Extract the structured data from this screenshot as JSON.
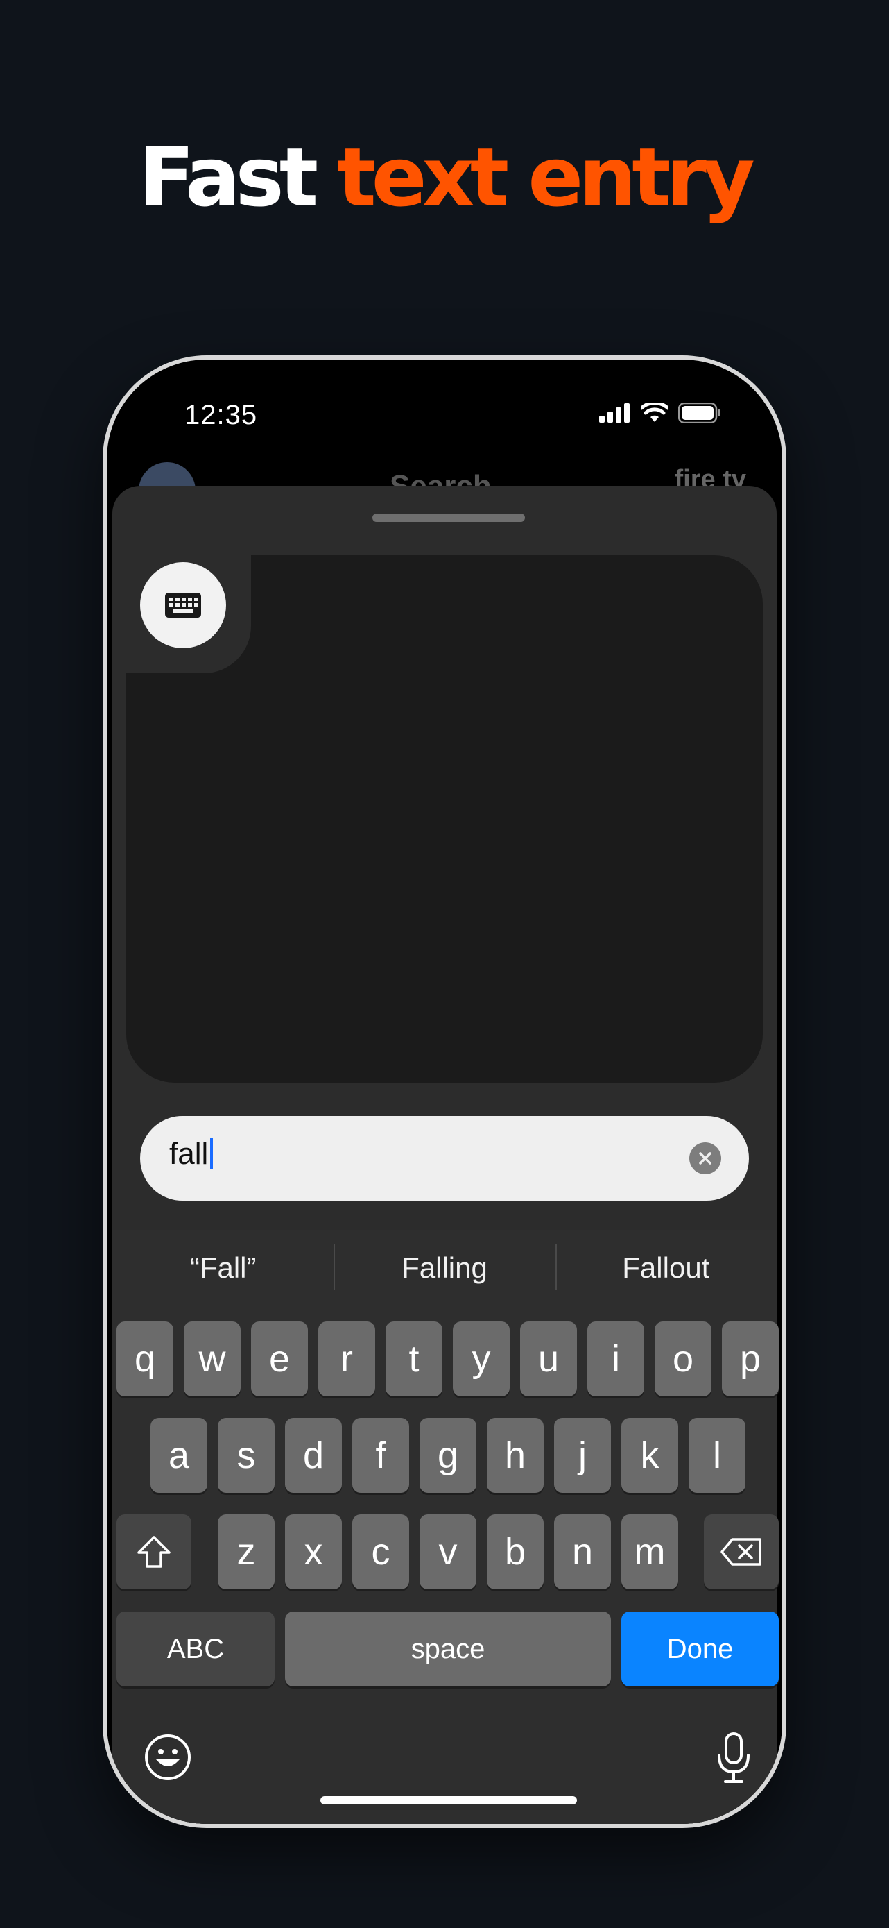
{
  "headline": {
    "part1": "Fast",
    "part2": "text entry"
  },
  "status_bar": {
    "time": "12:35"
  },
  "background_screen": {
    "title": "Search",
    "brand": "fire tv"
  },
  "search": {
    "value": "fall"
  },
  "suggestions": [
    "“Fall”",
    "Falling",
    "Fallout"
  ],
  "keyboard": {
    "row1": [
      "q",
      "w",
      "e",
      "r",
      "t",
      "y",
      "u",
      "i",
      "o",
      "p"
    ],
    "row2": [
      "a",
      "s",
      "d",
      "f",
      "g",
      "h",
      "j",
      "k",
      "l"
    ],
    "row3": [
      "z",
      "x",
      "c",
      "v",
      "b",
      "n",
      "m"
    ],
    "abc_label": "ABC",
    "space_label": "space",
    "done_label": "Done"
  },
  "icons": {
    "keyboard_toggle": "keyboard-icon",
    "clear": "clear-icon",
    "shift": "shift-icon",
    "delete": "delete-icon",
    "emoji": "emoji-icon",
    "mic": "microphone-icon"
  },
  "colors": {
    "accent": "#ff5400",
    "done_key": "#0a84ff",
    "background": "#0f141b"
  }
}
